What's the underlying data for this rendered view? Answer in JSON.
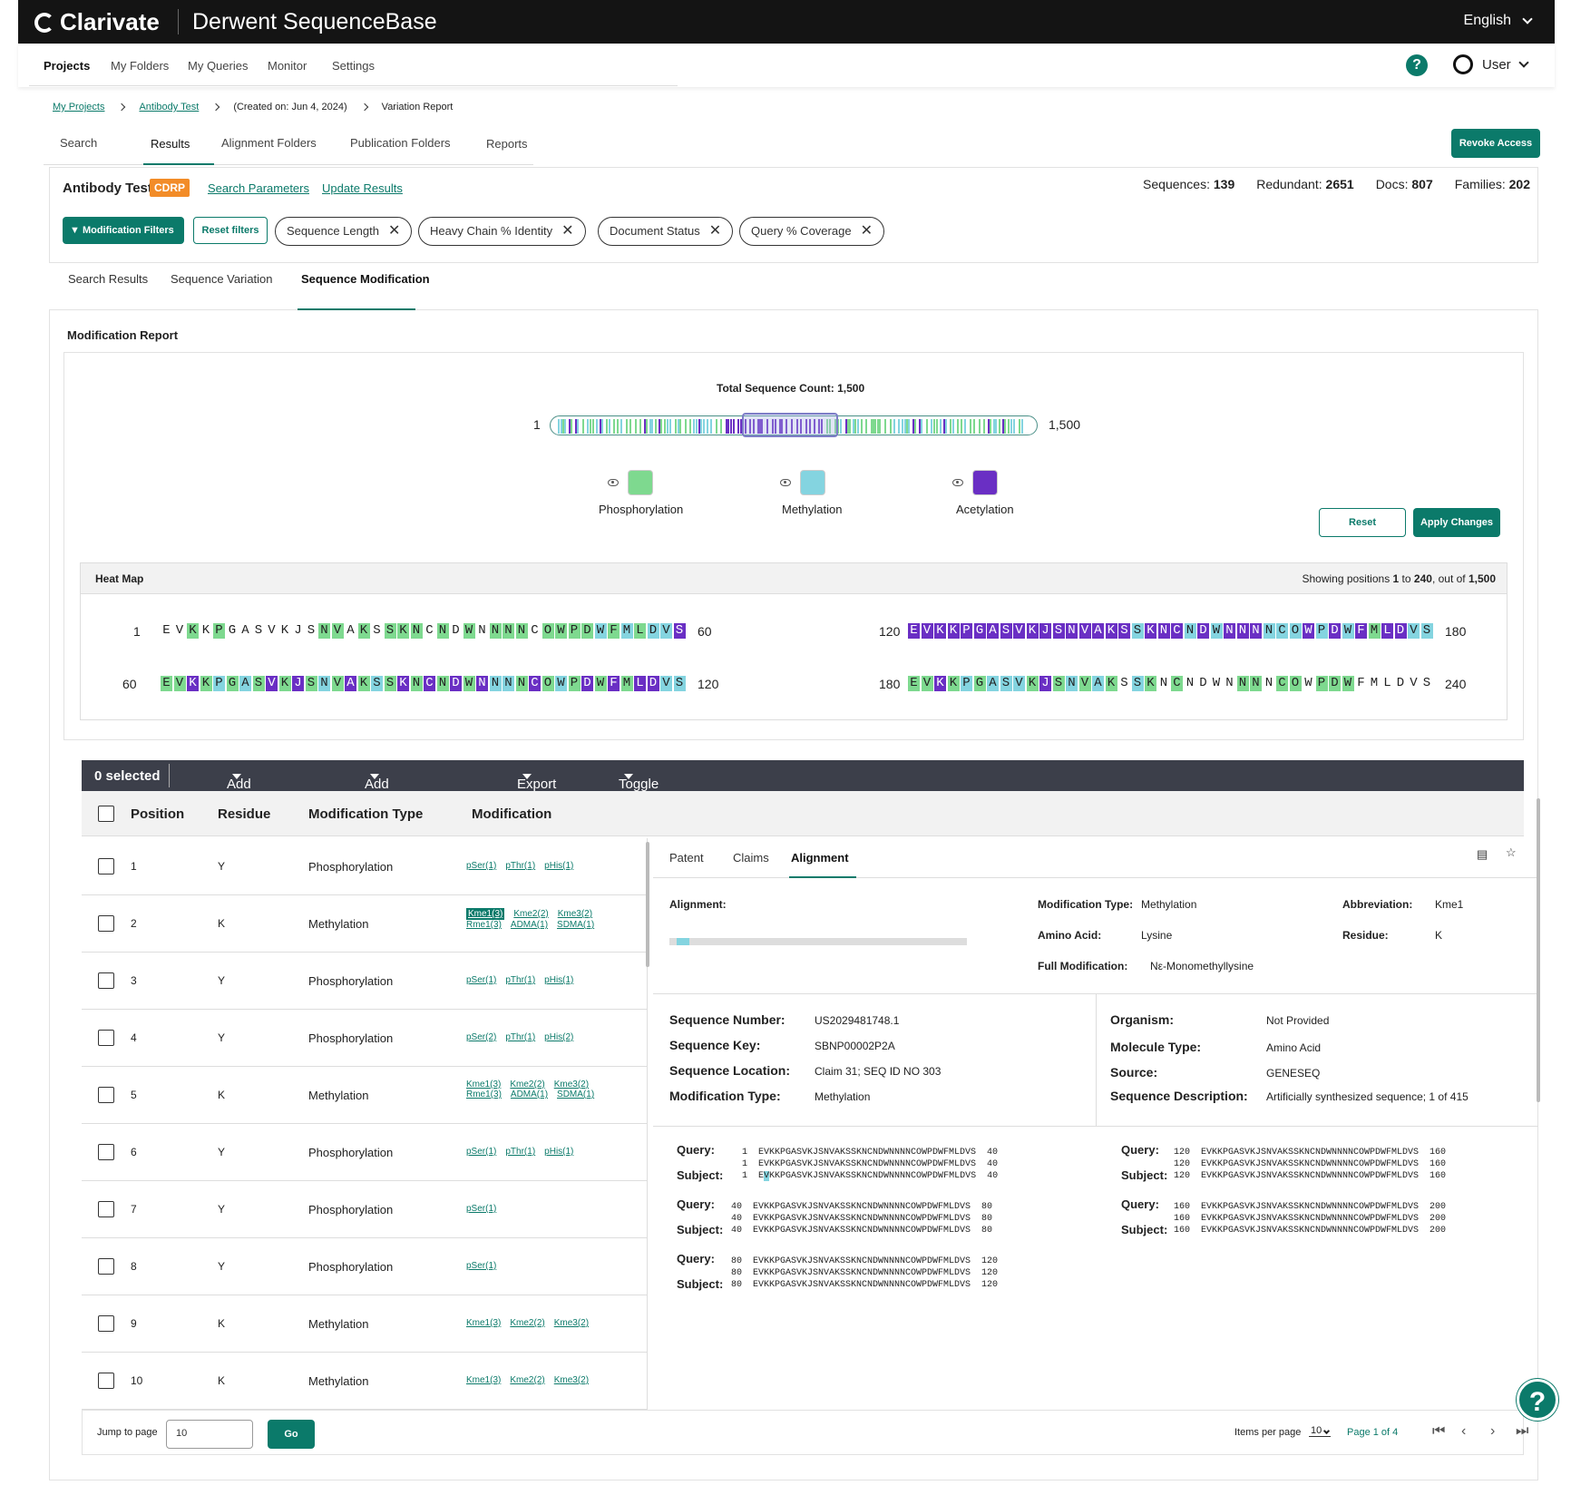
{
  "brand": {
    "name": "Clarivate",
    "product": "Derwent SequenceBase"
  },
  "lang": "English",
  "nav": [
    "Projects",
    "My Folders",
    "My Queries",
    "Monitor",
    "Settings"
  ],
  "user": "User",
  "help": "?",
  "breadcrumb": {
    "b1": "My Projects",
    "b2": "Antibody Test",
    "b3": "(Created on: Jun 4, 2024)",
    "b4": "Variation Report"
  },
  "tabs1": [
    "Search",
    "Results",
    "Alignment Folders",
    "Publication Folders",
    "Reports"
  ],
  "revoke": "Revoke Access",
  "project": {
    "name": "Antibody Test",
    "badge": "CDRP",
    "link1": "Search Parameters",
    "link2": "Update Results"
  },
  "stats": {
    "seq_l": "Sequences:",
    "seq_v": "139",
    "red_l": "Redundant:",
    "red_v": "2651",
    "docs_l": "Docs:",
    "docs_v": "807",
    "fam_l": "Families:",
    "fam_v": "202"
  },
  "filters": {
    "modbtn": "Modification Filters",
    "reset": "Reset filters",
    "chips": [
      "Sequence Length",
      "Heavy Chain % Identity",
      "Document Status",
      "Query % Coverage"
    ]
  },
  "tabs2": [
    "Search Results",
    "Sequence Variation",
    "Sequence Modification"
  ],
  "report": {
    "title": "Modification Report",
    "total": "Total Sequence Count: 1,500",
    "min": "1",
    "max": "1,500",
    "legend": [
      {
        "label": "Phosphorylation",
        "color": "#7ed98f"
      },
      {
        "label": "Methylation",
        "color": "#84d4e0"
      },
      {
        "label": "Acetylation",
        "color": "#6a2fc4"
      }
    ],
    "reset": "Reset",
    "apply": "Apply Changes"
  },
  "heatmap": {
    "title": "Heat Map",
    "showing_pre": "Showing positions ",
    "showing_a": "1",
    "showing_mid": " to ",
    "showing_b": "240",
    "showing_post": ", out of ",
    "showing_c": "1,500",
    "rows": [
      {
        "start": "1",
        "end": "60",
        "seq": "EVKKPGASVKJSNVAKSSKNCNDWNNNNCOWPDWFMLDVS",
        "c": "00101000000011010111010101110111121212233"
      },
      {
        "start": "60",
        "end": "120",
        "seq": "EVKKPGASVKJSNVAKSSKNCNDWNNNNCOWPDWFMLDVS",
        "c": "1131212131312131213131313221312131313322"
      },
      {
        "start": "120",
        "end": "180",
        "seq": "EVKKPGASVKJSNVAKSSKNCNDWNNNNCOWPDWFMLDVS",
        "c": "3333333333333333323332323332223232313322"
      },
      {
        "start": "180",
        "end": "240",
        "seq": "EVKKPGASVKJSNVAKSSKNCNDWNNNNCOWPDWFMLDVS",
        "c": "1131212221312121021010000110110111000000"
      }
    ]
  },
  "toolbar": {
    "selected": "0 selected",
    "add_sel": "Add selected",
    "add_all": "Add all results",
    "export": "Export",
    "toggle": "Toggle columns"
  },
  "table": {
    "headers": [
      "Position",
      "Residue",
      "Modification Type",
      "Modification"
    ],
    "rows": [
      {
        "pos": "1",
        "res": "Y",
        "type": "Phosphorylation",
        "mods": [
          "pSer(1)",
          "pThr(1)",
          "pHis(1)"
        ]
      },
      {
        "pos": "2",
        "res": "K",
        "type": "Methylation",
        "mods": [
          "Kme1(3)",
          "Kme2(2)",
          "Kme3(2)",
          "Rme1(3)",
          "ADMA(1)",
          "SDMA(1)"
        ]
      },
      {
        "pos": "3",
        "res": "Y",
        "type": "Phosphorylation",
        "mods": [
          "pSer(1)",
          "pThr(1)",
          "pHis(1)"
        ]
      },
      {
        "pos": "4",
        "res": "Y",
        "type": "Phosphorylation",
        "mods": [
          "pSer(2)",
          "pThr(1)",
          "pHis(2)"
        ]
      },
      {
        "pos": "5",
        "res": "K",
        "type": "Methylation",
        "mods": [
          "Kme1(3)",
          "Kme2(2)",
          "Kme3(2)",
          "Rme1(3)",
          "ADMA(1)",
          "SDMA(1)"
        ]
      },
      {
        "pos": "6",
        "res": "Y",
        "type": "Phosphorylation",
        "mods": [
          "pSer(1)",
          "pThr(1)",
          "pHis(1)"
        ]
      },
      {
        "pos": "7",
        "res": "Y",
        "type": "Phosphorylation",
        "mods": [
          "pSer(1)"
        ]
      },
      {
        "pos": "8",
        "res": "Y",
        "type": "Phosphorylation",
        "mods": [
          "pSer(1)"
        ]
      },
      {
        "pos": "9",
        "res": "K",
        "type": "Methylation",
        "mods": [
          "Kme1(3)",
          "Kme2(2)",
          "Kme3(2)"
        ]
      },
      {
        "pos": "10",
        "res": "K",
        "type": "Methylation",
        "mods": [
          "Kme1(3)",
          "Kme2(2)",
          "Kme3(2)"
        ]
      }
    ]
  },
  "detail": {
    "tabs": [
      "Patent",
      "Claims",
      "Alignment"
    ],
    "alignment_l": "Alignment:",
    "modtype_l": "Modification Type:",
    "modtype_v": "Methylation",
    "abbr_l": "Abbreviation:",
    "abbr_v": "Kme1",
    "amino_l": "Amino Acid:",
    "amino_v": "Lysine",
    "residue_l": "Residue:",
    "residue_v": "K",
    "full_l": "Full Modification:",
    "full_v": "Nε-Monomethyllysine",
    "seqnum_l": "Sequence Number:",
    "seqnum_v": "US2029481748.1",
    "seqkey_l": "Sequence Key:",
    "seqkey_v": "SBNP00002P2A",
    "seqloc_l": "Sequence Location:",
    "seqloc_v": "Claim 31; SEQ ID NO 303",
    "mt2_l": "Modification Type:",
    "mt2_v": "Methylation",
    "org_l": "Organism:",
    "org_v": "Not Provided",
    "mol_l": "Molecule Type:",
    "mol_v": "Amino Acid",
    "src_l": "Source:",
    "src_v": "GENESEQ",
    "desc_l": "Sequence Description:",
    "desc_v": "Artificially synthesized sequence; 1 of 415",
    "query": "Query:",
    "subject": "Subject:",
    "blocks": [
      {
        "l1": "  1  EVKKPGASVKJSNVAKSSKNCNDWNNNNCOWPDWFMLDVS  40",
        "l2": "  1  EVKKPGASVKJSNVAKSSKNCNDWNNNNCOWPDWFMLDVS  40",
        "l3a": "  1  E",
        "l3h": "V",
        "l3b": "KKPGASVKJSNVAKSSKNCNDWNNNNCOWPDWFMLDVS  40"
      },
      {
        "l1": " 40  EVKKPGASVKJSNVAKSSKNCNDWNNNNCOWPDWFMLDVS  80",
        "l2": " 40  EVKKPGASVKJSNVAKSSKNCNDWNNNNCOWPDWFMLDVS  80",
        "l3": " 40  EVKKPGASVKJSNVAKSSKNCNDWNNNNCOWPDWFMLDVS  80"
      },
      {
        "l1": " 80  EVKKPGASVKJSNVAKSSKNCNDWNNNNCOWPDWFMLDVS  120",
        "l2": " 80  EVKKPGASVKJSNVAKSSKNCNDWNNNNCOWPDWFMLDVS  120",
        "l3": " 80  EVKKPGASVKJSNVAKSSKNCNDWNNNNCOWPDWFMLDVS  120"
      },
      {
        "l1": "120  EVKKPGASVKJSNVAKSSKNCNDWNNNNCOWPDWFMLDVS  160",
        "l2": "120  EVKKPGASVKJSNVAKSSKNCNDWNNNNCOWPDWFMLDVS  160",
        "l3": "120  EVKKPGASVKJSNVAKSSKNCNDWNNNNCOWPDWFMLDVS  160"
      },
      {
        "l1": "160  EVKKPGASVKJSNVAKSSKNCNDWNNNNCOWPDWFMLDVS  200",
        "l2": "160  EVKKPGASVKJSNVAKSSKNCNDWNNNNCOWPDWFMLDVS  200",
        "l3": "160  EVKKPGASVKJSNVAKSSKNCNDWNNNNCOWPDWFMLDVS  200"
      }
    ]
  },
  "footer": {
    "jump": "Jump to page",
    "jump_val": "10",
    "go": "Go",
    "ipp": "Items per page",
    "ipp_val": "10",
    "page": "Page 1 of 4"
  }
}
